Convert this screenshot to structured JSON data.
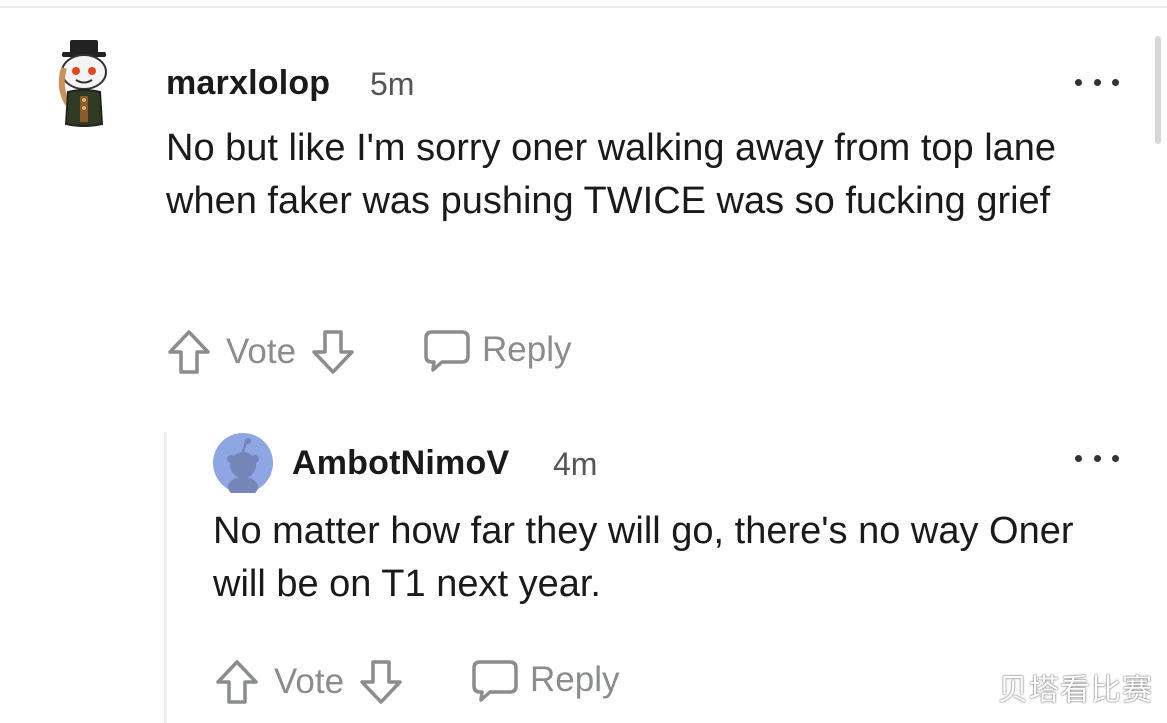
{
  "comments": [
    {
      "username": "marxlolop",
      "time": "5m",
      "body": "No but like I'm sorry oner walking away from top lane when faker was pushing TWICE was so fucking grief",
      "vote_label": "Vote",
      "reply_label": "Reply"
    },
    {
      "username": "AmbotNimoV",
      "time": "4m",
      "body": "No matter how far they will go, there's no way Oner will be on T1 next year.",
      "vote_label": "Vote",
      "reply_label": "Reply"
    }
  ],
  "watermark": "贝塔看比赛",
  "colors": {
    "text": "#1a1a1b",
    "muted": "#8a8c8e",
    "avatar_bg": "#8fa6e4",
    "thread_line": "#edeff1"
  },
  "icons": {
    "upvote": "arrow-up-outline-icon",
    "downvote": "arrow-down-outline-icon",
    "reply": "speech-bubble-icon",
    "more": "three-dots-icon"
  }
}
